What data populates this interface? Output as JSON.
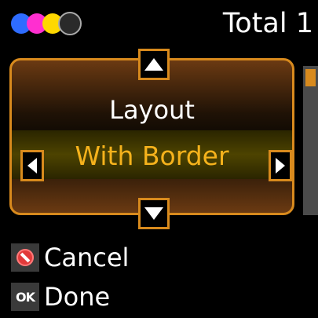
{
  "status": {
    "ink_colors": [
      "#2e6cff",
      "#ff2fd0",
      "#ffd800",
      "#2a2a2a"
    ],
    "total_label": "Total 1"
  },
  "setting": {
    "title": "Layout",
    "value": "With Border"
  },
  "actions": {
    "cancel_label": "Cancel",
    "done_key": "OK",
    "done_label": "Done"
  },
  "colors": {
    "accent": "#d88a1d",
    "value_text": "#f5b21c"
  }
}
